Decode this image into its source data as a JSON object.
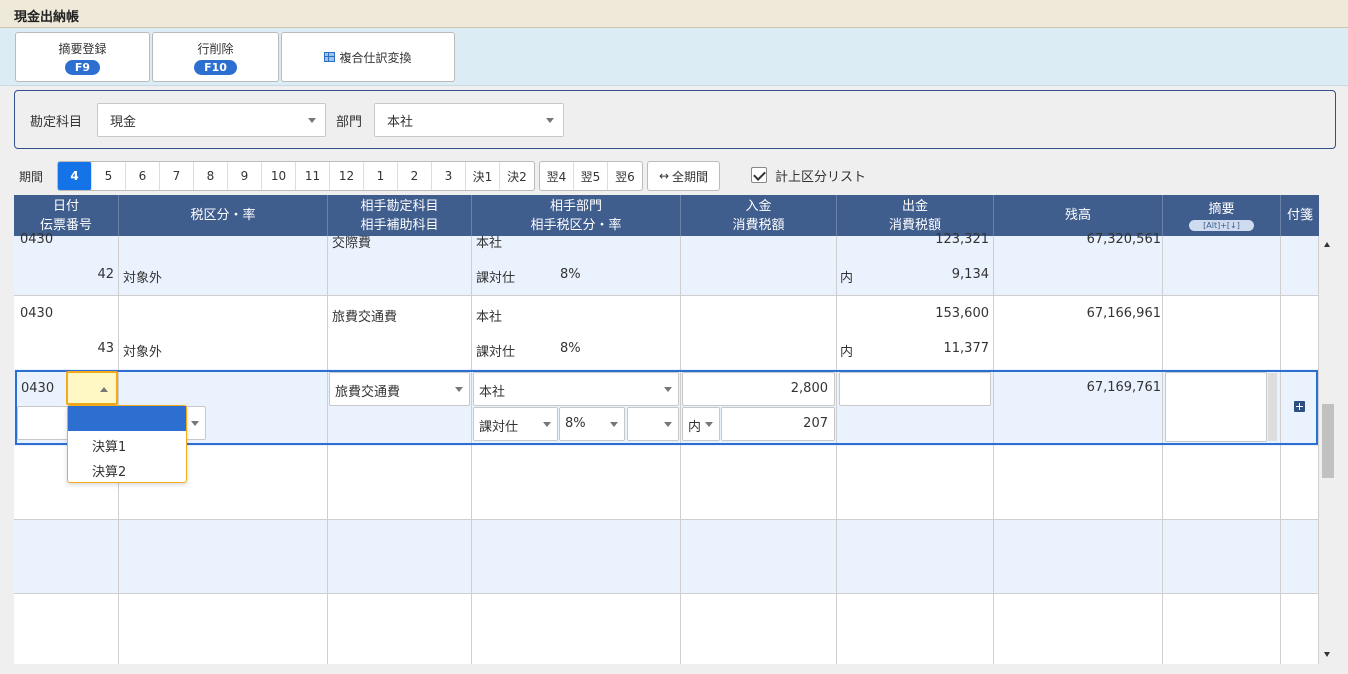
{
  "window": {
    "title": "現金出納帳"
  },
  "toolbar": {
    "summary_register": {
      "label": "摘要登録",
      "key": "F9"
    },
    "delete_row": {
      "label": "行削除",
      "key": "F10"
    },
    "compound_journal": {
      "label": "複合仕訳変換",
      "icon": "grid-icon"
    }
  },
  "filter": {
    "account_label": "勘定科目",
    "account_value": "現金",
    "department_label": "部門",
    "department_value": "本社"
  },
  "periods": {
    "label": "期間",
    "months": [
      "4",
      "5",
      "6",
      "7",
      "8",
      "9",
      "10",
      "11",
      "12",
      "1",
      "2",
      "3",
      "決1",
      "決2"
    ],
    "active": "4",
    "next_year": [
      "翌4",
      "翌5",
      "翌6"
    ],
    "all_period": "全期間",
    "all_period_icon": "left-right-arrow-icon",
    "posting_list_label": "計上区分リスト",
    "posting_list_checked": true
  },
  "grid": {
    "headers": {
      "date": "日付",
      "voucher_no": "伝票番号",
      "tax_rate": "税区分・率",
      "counter_account": "相手勘定科目",
      "counter_sub_account": "相手補助科目",
      "counter_department": "相手部門",
      "counter_tax_rate": "相手税区分・率",
      "deposit": "入金",
      "deposit_tax": "消費税額",
      "withdrawal": "出金",
      "withdrawal_tax": "消費税額",
      "balance": "残高",
      "summary": "摘要",
      "summary_shortcut": "[Alt]+[↓]",
      "attachment": "付箋"
    },
    "rows": [
      {
        "date": "0430",
        "voucher": "42",
        "tax": "対象外",
        "account": "交際費",
        "department": "本社",
        "counter_tax": "課対仕",
        "counter_rate": "8%",
        "withdrawal": "123,321",
        "w_tax_type": "内",
        "w_tax": "9,134",
        "balance": "67,320,561"
      },
      {
        "date": "0430",
        "voucher": "43",
        "tax": "対象外",
        "account": "旅費交通費",
        "department": "本社",
        "counter_tax": "課対仕",
        "counter_rate": "8%",
        "withdrawal": "153,600",
        "w_tax_type": "内",
        "w_tax": "11,377",
        "balance": "67,166,961"
      }
    ],
    "edit_row": {
      "date": "0430",
      "account": "旅費交通費",
      "department": "本社",
      "counter_tax": "課対仕",
      "counter_rate": "8%",
      "deposit": "2,800",
      "tax_type": "内",
      "deposit_tax": "207",
      "balance": "67,169,761"
    },
    "dropdown_options": [
      "",
      "決算1",
      "決算2"
    ]
  }
}
